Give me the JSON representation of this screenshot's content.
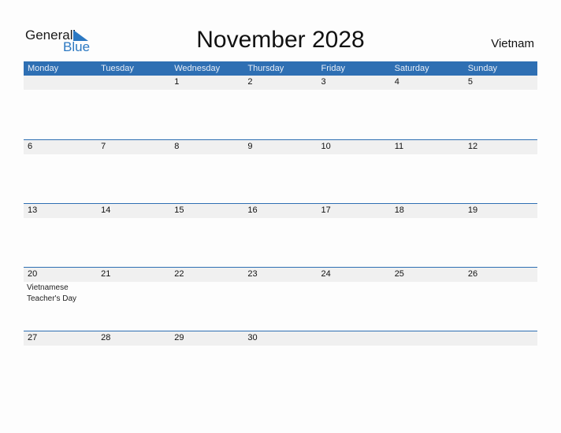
{
  "logo": {
    "general": "General",
    "blue": "Blue"
  },
  "title": "November 2028",
  "country": "Vietnam",
  "colors": {
    "accent": "#2e6fb3",
    "band": "#f0f0f0"
  },
  "weekdays": [
    "Monday",
    "Tuesday",
    "Wednesday",
    "Thursday",
    "Friday",
    "Saturday",
    "Sunday"
  ],
  "weeks": [
    [
      "",
      "",
      "1",
      "2",
      "3",
      "4",
      "5"
    ],
    [
      "6",
      "7",
      "8",
      "9",
      "10",
      "11",
      "12"
    ],
    [
      "13",
      "14",
      "15",
      "16",
      "17",
      "18",
      "19"
    ],
    [
      "20",
      "21",
      "22",
      "23",
      "24",
      "25",
      "26"
    ],
    [
      "27",
      "28",
      "29",
      "30",
      "",
      "",
      ""
    ]
  ],
  "events": {
    "3-0": "Vietnamese Teacher's Day"
  }
}
